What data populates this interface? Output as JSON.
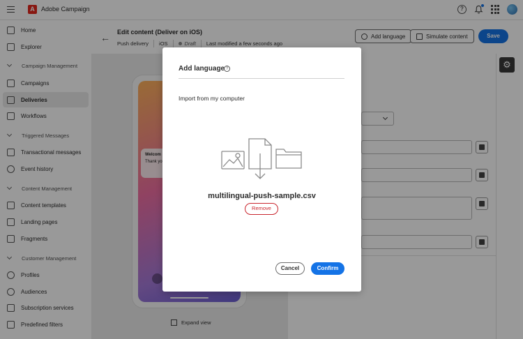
{
  "app": {
    "brand": "Adobe Campaign",
    "logo_letter": "A"
  },
  "topbar": {
    "help_glyph": "?"
  },
  "sidebar": {
    "home": "Home",
    "explorer": "Explorer",
    "section_campaign": "Campaign Management",
    "campaigns": "Campaigns",
    "deliveries": "Deliveries",
    "workflows": "Workflows",
    "section_triggered": "Triggered Messages",
    "transactional": "Transactional messages",
    "event_history": "Event history",
    "section_content": "Content Management",
    "content_templates": "Content templates",
    "landing_pages": "Landing pages",
    "fragments": "Fragments",
    "section_customer": "Customer Management",
    "profiles": "Profiles",
    "audiences": "Audiences",
    "subscription_services": "Subscription services",
    "predefined_filters": "Predefined filters"
  },
  "header": {
    "title": "Edit content (Deliver on iOS)",
    "type": "Push delivery",
    "platform": "iOS",
    "status": "Draft",
    "modified": "Last modified a few seconds ago",
    "add_language": "Add language",
    "simulate_content": "Simulate content",
    "save": "Save"
  },
  "preview": {
    "notif_title": "Welcom",
    "notif_body": "Thank yo",
    "expand_view": "Expand view"
  },
  "modal": {
    "title": "Add language",
    "subtitle": "Import from my computer",
    "file_name": "multilingual-push-sample.csv",
    "remove": "Remove",
    "cancel": "Cancel",
    "confirm": "Confirm"
  },
  "colors": {
    "accent": "#1473e6",
    "remove": "#c9252d",
    "brand_logo": "#e3271d"
  }
}
